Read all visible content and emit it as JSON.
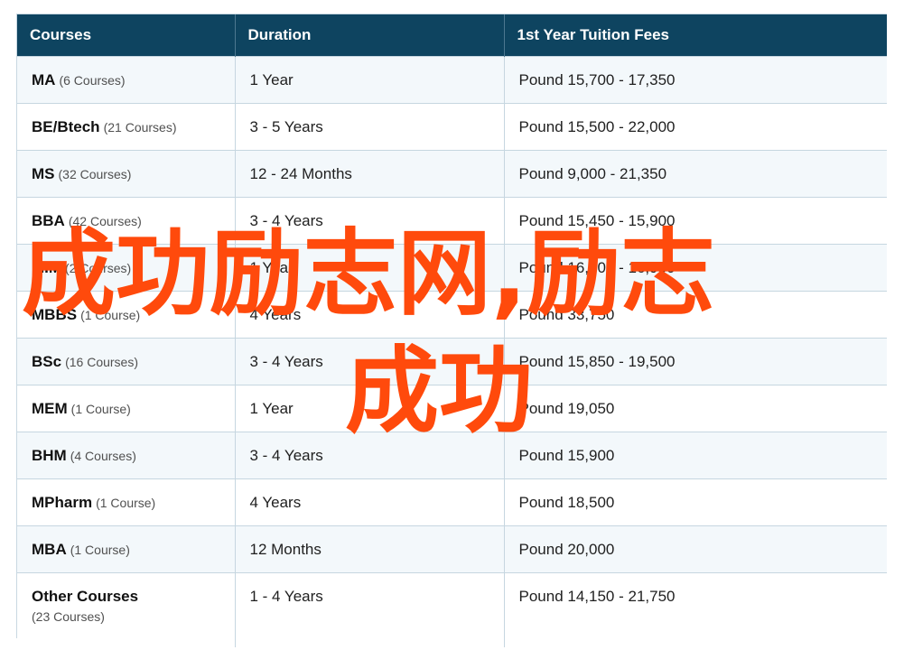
{
  "table": {
    "headers": [
      "Courses",
      "Duration",
      "1st Year Tuition Fees"
    ],
    "rows": [
      {
        "course": "MA",
        "count": "(6 Courses)",
        "duration": "1 Year",
        "fees": "Pound 15,700 - 17,350"
      },
      {
        "course": "BE/Btech",
        "count": "(21 Courses)",
        "duration": "3 - 5 Years",
        "fees": "Pound 15,500 - 22,000"
      },
      {
        "course": "MS",
        "count": "(32 Courses)",
        "duration": "12 - 24 Months",
        "fees": "Pound 9,000 - 21,350"
      },
      {
        "course": "BBA",
        "count": "(42 Courses)",
        "duration": "3 - 4 Years",
        "fees": "Pound 15,450 - 15,900"
      },
      {
        "course": "MIM",
        "count": "(2 Courses)",
        "duration": "1 Year",
        "fees": "Pound 16,400 - 16,950"
      },
      {
        "course": "MBBS",
        "count": "(1 Course)",
        "duration": "4 Years",
        "fees": "Pound 33,750"
      },
      {
        "course": "BSc",
        "count": "(16 Courses)",
        "duration": "3 - 4 Years",
        "fees": "Pound 15,850 - 19,500"
      },
      {
        "course": "MEM",
        "count": "(1 Course)",
        "duration": "1 Year",
        "fees": "Pound 19,050"
      },
      {
        "course": "BHM",
        "count": "(4 Courses)",
        "duration": "3 - 4 Years",
        "fees": "Pound 15,900"
      },
      {
        "course": "MPharm",
        "count": "(1 Course)",
        "duration": "4 Years",
        "fees": "Pound 18,500"
      },
      {
        "course": "MBA",
        "count": "(1 Course)",
        "duration": "12 Months",
        "fees": "Pound 20,000"
      },
      {
        "course": "Other Courses",
        "count": "(23 Courses)",
        "duration": "1 - 4 Years",
        "fees": "Pound 14,150 - 21,750"
      }
    ]
  },
  "watermark": {
    "line1": "成功励志网,励志",
    "line2": "成功",
    "color": "#ff4a0c"
  },
  "colors": {
    "header_bg": "#0e4460",
    "stripe_bg": "#f3f8fb"
  }
}
